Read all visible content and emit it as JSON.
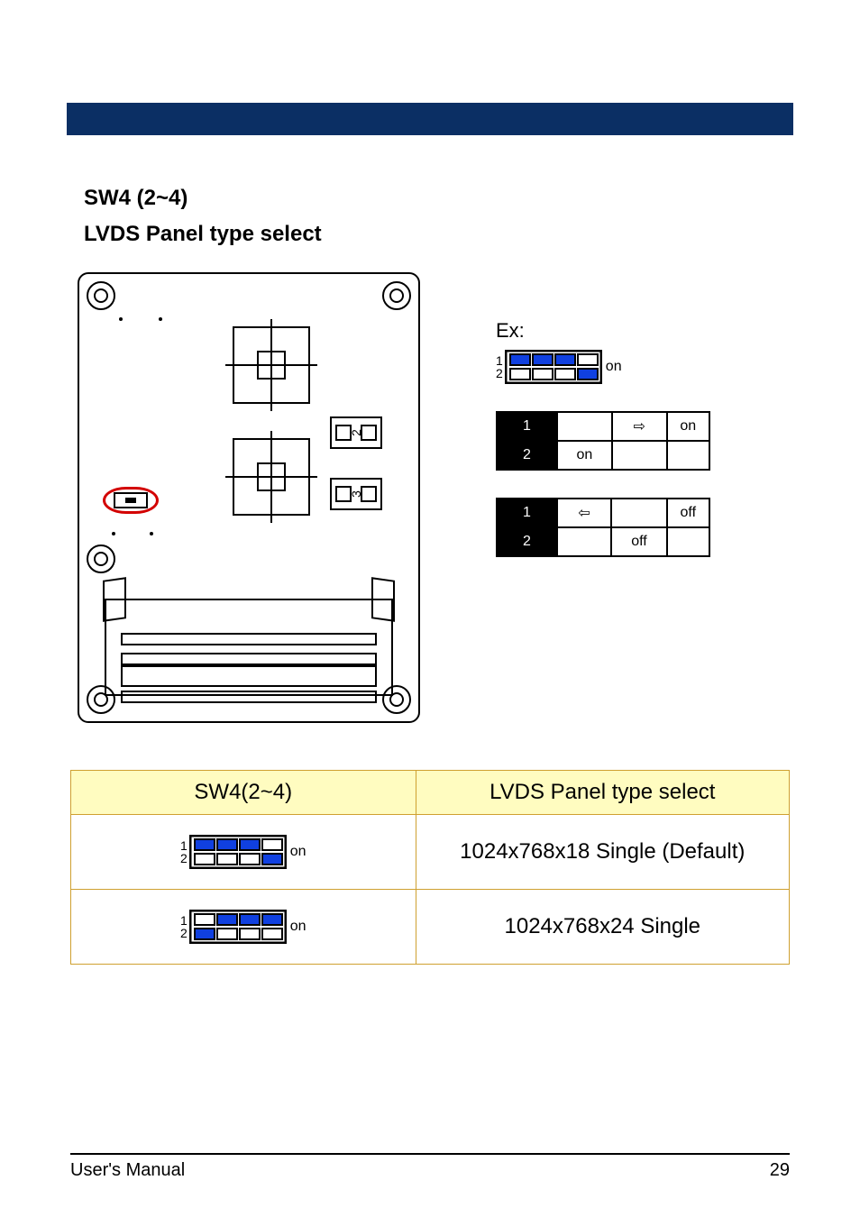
{
  "header_bar": "",
  "sw_code": "SW4 (2~4)",
  "sw_name": "LVDS Panel type select",
  "example_label": "Ex:",
  "switch_labels": {
    "row1": "1",
    "row2": "2",
    "on": "on"
  },
  "switch_diagrams": {
    "example": [
      1,
      1,
      1,
      0
    ],
    "row1": [
      1,
      1,
      1,
      0
    ],
    "row2": [
      0,
      1,
      1,
      1
    ]
  },
  "conn_numbers": {
    "s1": "2",
    "s2": "3"
  },
  "mini_table_a": {
    "r1": {
      "switch": "1",
      "c1": "⇨",
      "c2": "on"
    },
    "r2": {
      "switch": "2",
      "c1": "on",
      "c2": ""
    }
  },
  "mini_table_b": {
    "r1": {
      "switch": "1",
      "c1": "⇦",
      "c2": "off"
    },
    "r2": {
      "switch": "2",
      "c1": "off",
      "c2": ""
    }
  },
  "settings_table": {
    "head": {
      "c1": "SW4(2~4)",
      "c2": "LVDS Panel type select"
    },
    "rows": [
      {
        "label": "1024x768x18 Single (Default)"
      },
      {
        "label": "1024x768x24 Single"
      }
    ]
  },
  "footer": {
    "left": "User's Manual",
    "right": "29"
  }
}
